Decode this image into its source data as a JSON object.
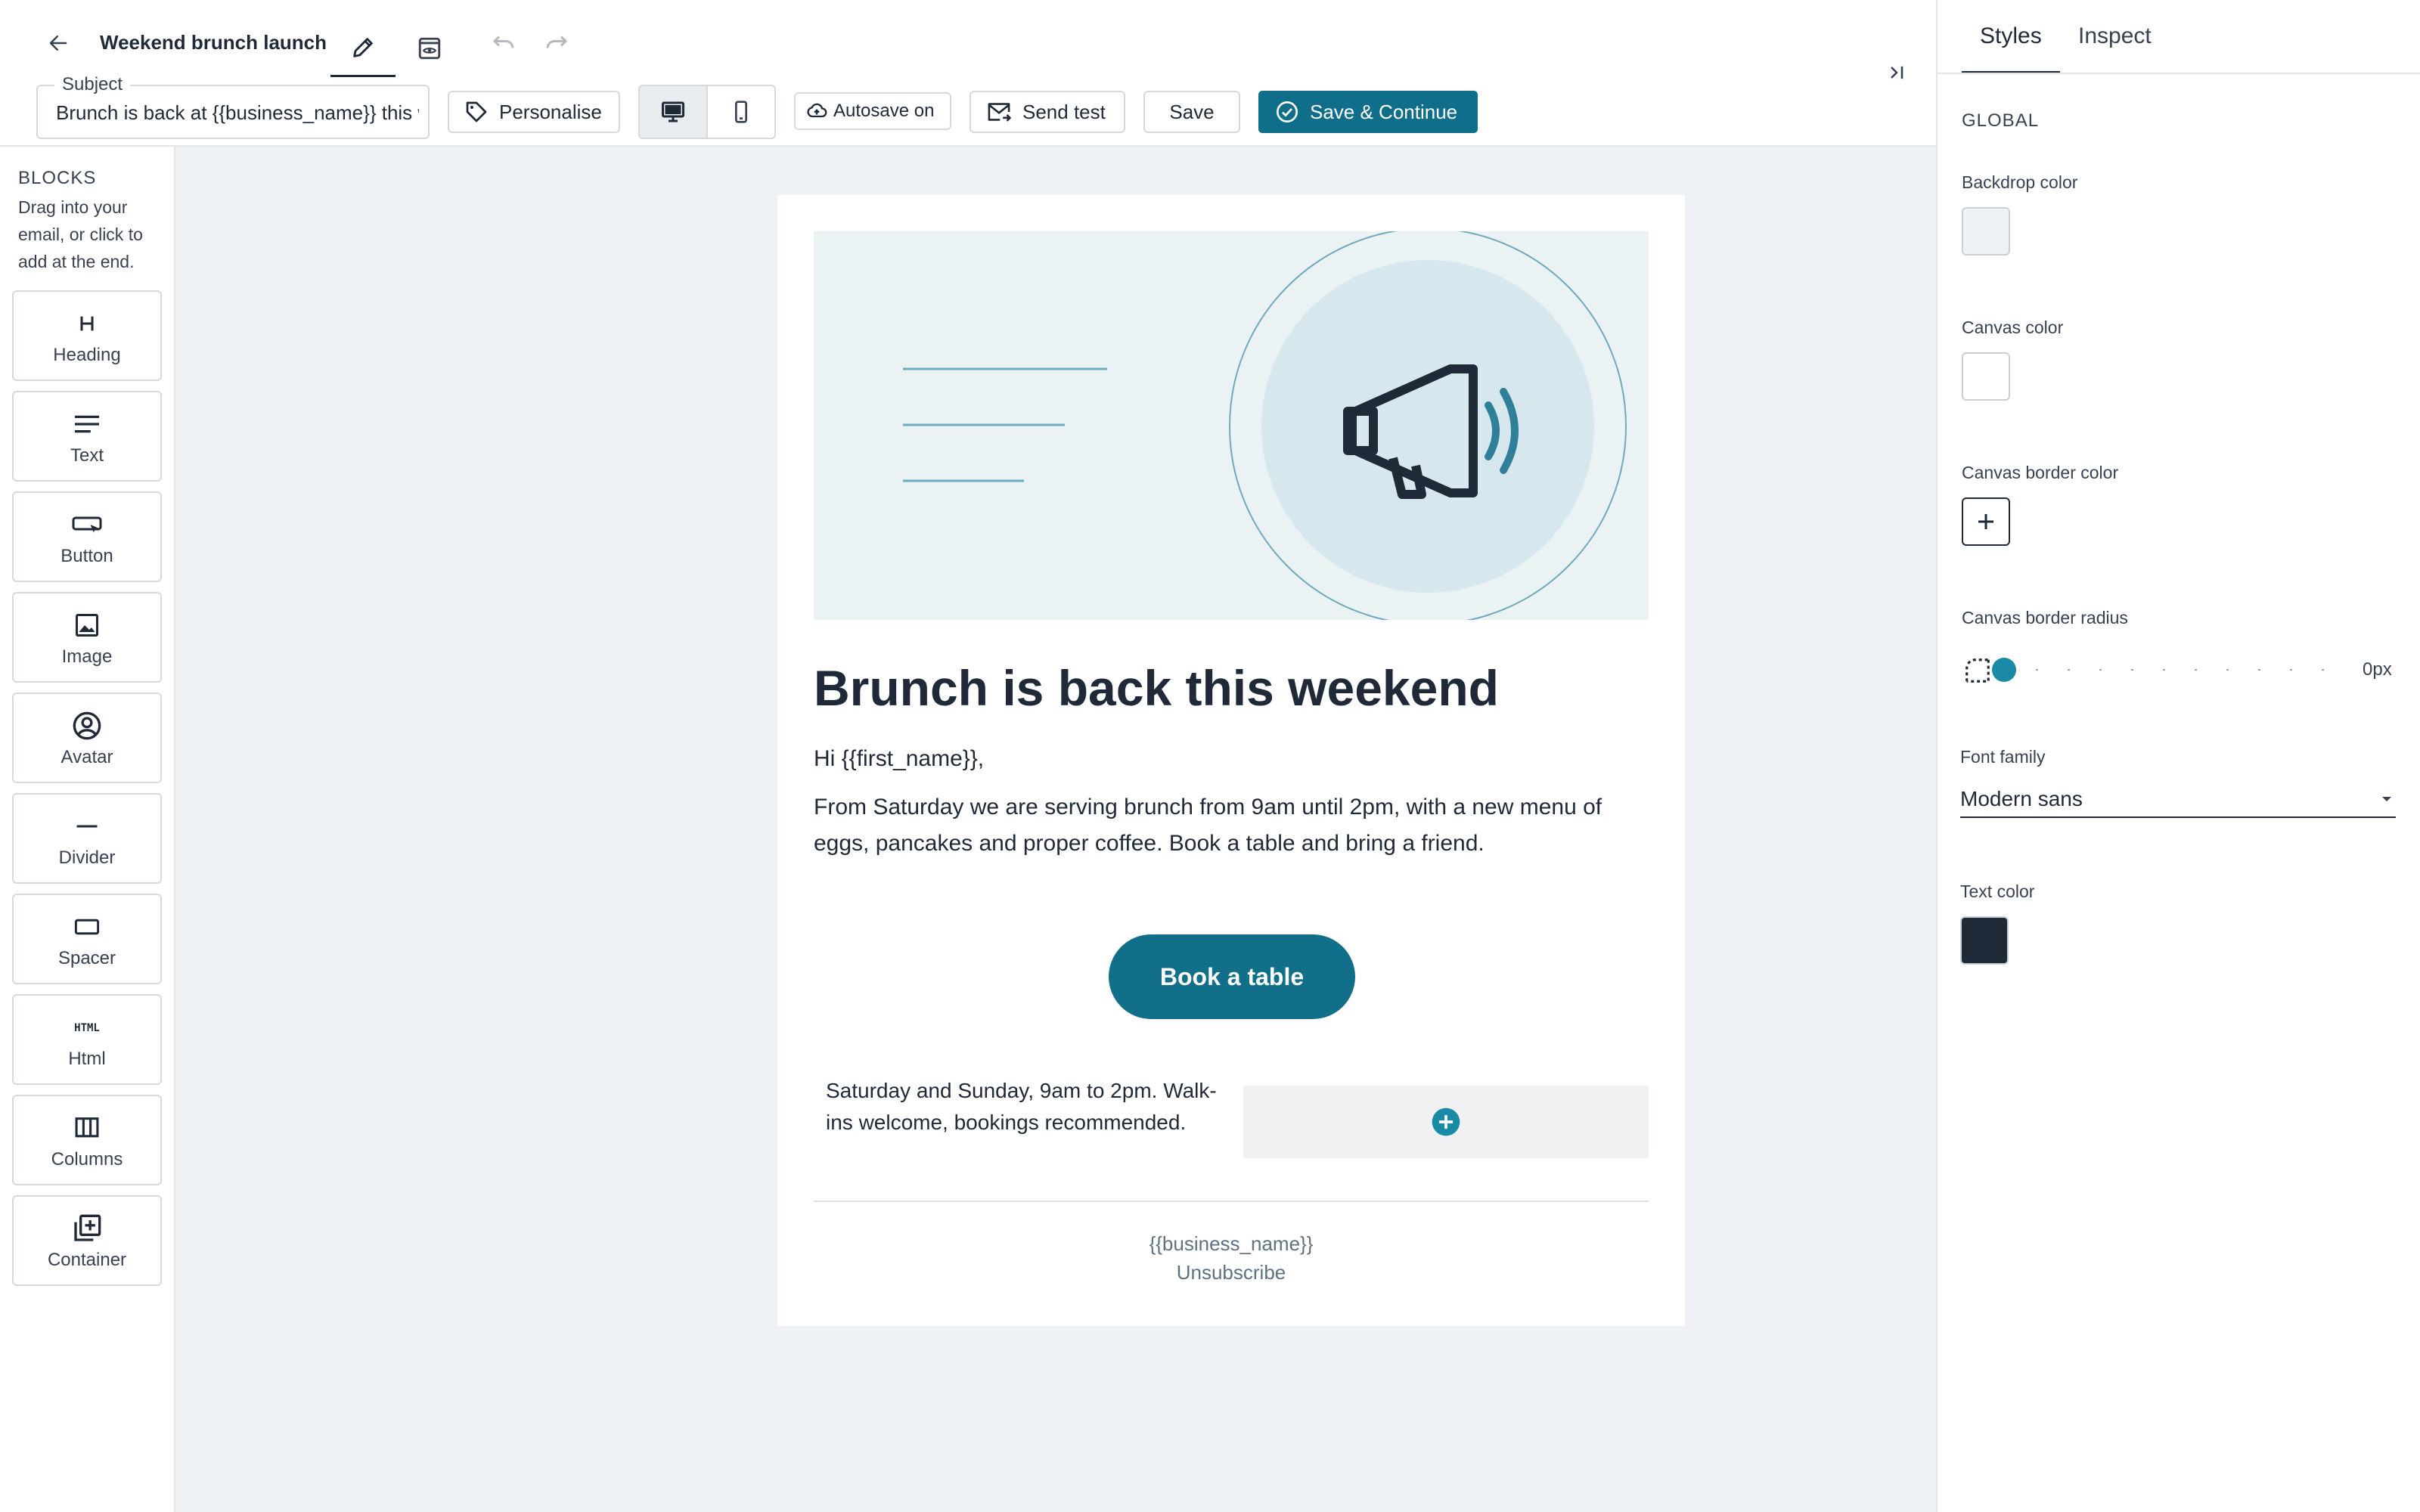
{
  "header": {
    "title": "Weekend brunch launch",
    "subject_label": "Subject",
    "subject_value": "Brunch is back at {{business_name}} this weekend",
    "personalise_label": "Personalise",
    "autosave_label": "Autosave on",
    "send_test_label": "Send test",
    "save_label": "Save",
    "save_continue_label": "Save & Continue"
  },
  "blocks": {
    "title": "BLOCKS",
    "help": "Drag into your email, or click to add at the end.",
    "items": [
      {
        "label": "Heading",
        "icon": "heading-icon"
      },
      {
        "label": "Text",
        "icon": "text-icon"
      },
      {
        "label": "Button",
        "icon": "button-icon"
      },
      {
        "label": "Image",
        "icon": "image-icon"
      },
      {
        "label": "Avatar",
        "icon": "avatar-icon"
      },
      {
        "label": "Divider",
        "icon": "divider-icon"
      },
      {
        "label": "Spacer",
        "icon": "spacer-icon"
      },
      {
        "label": "Html",
        "icon": "html-icon"
      },
      {
        "label": "Columns",
        "icon": "columns-icon"
      },
      {
        "label": "Container",
        "icon": "container-icon"
      }
    ]
  },
  "email": {
    "heading": "Brunch is back this weekend",
    "greeting": "Hi {{first_name}},",
    "body": "From Saturday we are serving brunch from 9am until 2pm, with a new menu of eggs, pancakes and proper coffee. Book a table and bring a friend.",
    "button_label": "Book a table",
    "hours": "Saturday and Sunday, 9am to 2pm. Walk-ins welcome, bookings recommended.",
    "footer_business": "{{business_name}}",
    "footer_unsubscribe": "Unsubscribe"
  },
  "styles_panel": {
    "tabs": [
      "Styles",
      "Inspect"
    ],
    "active_tab": "Styles",
    "section": "GLOBAL",
    "backdrop_label": "Backdrop color",
    "backdrop_color": "#eef2f4",
    "canvas_label": "Canvas color",
    "canvas_color": "#ffffff",
    "border_color_label": "Canvas border color",
    "border_radius_label": "Canvas border radius",
    "border_radius_value": "0px",
    "border_radius_fraction": 0,
    "font_family_label": "Font family",
    "font_family_value": "Modern sans",
    "text_color_label": "Text color",
    "text_color": "#1f2937"
  },
  "colors": {
    "accent": "#126f8a",
    "hero_bg": "#eaf2f4"
  }
}
